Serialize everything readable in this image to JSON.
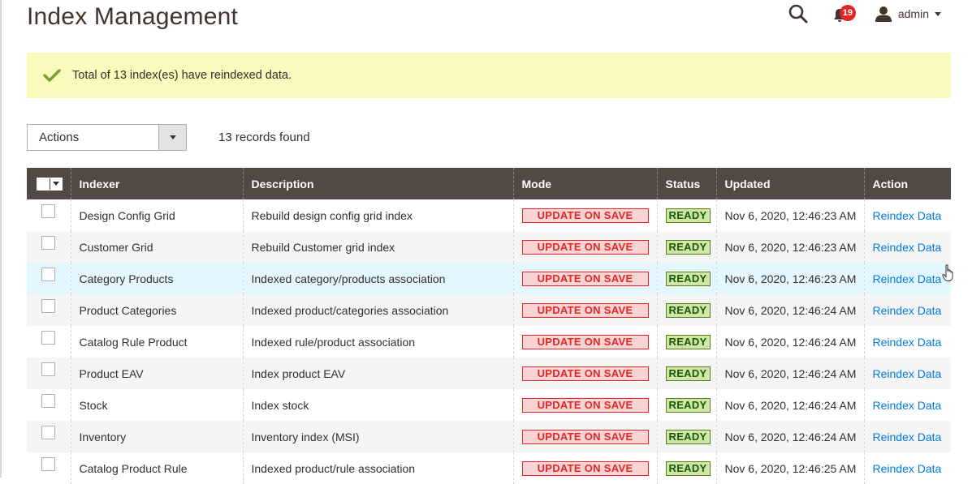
{
  "page": {
    "title": "Index Management"
  },
  "header": {
    "notifications_count": "19",
    "user_name": "admin"
  },
  "message": {
    "text": "Total of 13 index(es) have reindexed data."
  },
  "toolbar": {
    "actions_label": "Actions",
    "records_found": "13 records found"
  },
  "grid": {
    "columns": [
      "Indexer",
      "Description",
      "Mode",
      "Status",
      "Updated",
      "Action"
    ],
    "rows": [
      {
        "indexer": "Design Config Grid",
        "description": "Rebuild design config grid index",
        "mode": "UPDATE ON SAVE",
        "status": "READY",
        "updated": "Nov 6, 2020, 12:46:23 AM",
        "action": "Reindex Data"
      },
      {
        "indexer": "Customer Grid",
        "description": "Rebuild Customer grid index",
        "mode": "UPDATE ON SAVE",
        "status": "READY",
        "updated": "Nov 6, 2020, 12:46:23 AM",
        "action": "Reindex Data"
      },
      {
        "indexer": "Category Products",
        "description": "Indexed category/products association",
        "mode": "UPDATE ON SAVE",
        "status": "READY",
        "updated": "Nov 6, 2020, 12:46:23 AM",
        "action": "Reindex Data"
      },
      {
        "indexer": "Product Categories",
        "description": "Indexed product/categories association",
        "mode": "UPDATE ON SAVE",
        "status": "READY",
        "updated": "Nov 6, 2020, 12:46:24 AM",
        "action": "Reindex Data"
      },
      {
        "indexer": "Catalog Rule Product",
        "description": "Indexed rule/product association",
        "mode": "UPDATE ON SAVE",
        "status": "READY",
        "updated": "Nov 6, 2020, 12:46:24 AM",
        "action": "Reindex Data"
      },
      {
        "indexer": "Product EAV",
        "description": "Index product EAV",
        "mode": "UPDATE ON SAVE",
        "status": "READY",
        "updated": "Nov 6, 2020, 12:46:24 AM",
        "action": "Reindex Data"
      },
      {
        "indexer": "Stock",
        "description": "Index stock",
        "mode": "UPDATE ON SAVE",
        "status": "READY",
        "updated": "Nov 6, 2020, 12:46:24 AM",
        "action": "Reindex Data"
      },
      {
        "indexer": "Inventory",
        "description": "Inventory index (MSI)",
        "mode": "UPDATE ON SAVE",
        "status": "READY",
        "updated": "Nov 6, 2020, 12:46:24 AM",
        "action": "Reindex Data"
      },
      {
        "indexer": "Catalog Product Rule",
        "description": "Indexed product/rule association",
        "mode": "UPDATE ON SAVE",
        "status": "READY",
        "updated": "Nov 6, 2020, 12:46:25 AM",
        "action": "Reindex Data"
      }
    ]
  },
  "colors": {
    "header_bg": "#514943",
    "message_bg": "#fafabc",
    "success_check": "#79a22e",
    "mode_badge_border": "#e22626",
    "status_badge_bg": "#d0e5a9",
    "link": "#007bdb",
    "notification_badge": "#e22626"
  },
  "icons": {
    "search": "search-icon",
    "notifications": "bell-icon",
    "user": "user-icon",
    "message": "check-icon",
    "dropdown": "caret-down-icon",
    "pointer": "hand-cursor-icon"
  }
}
